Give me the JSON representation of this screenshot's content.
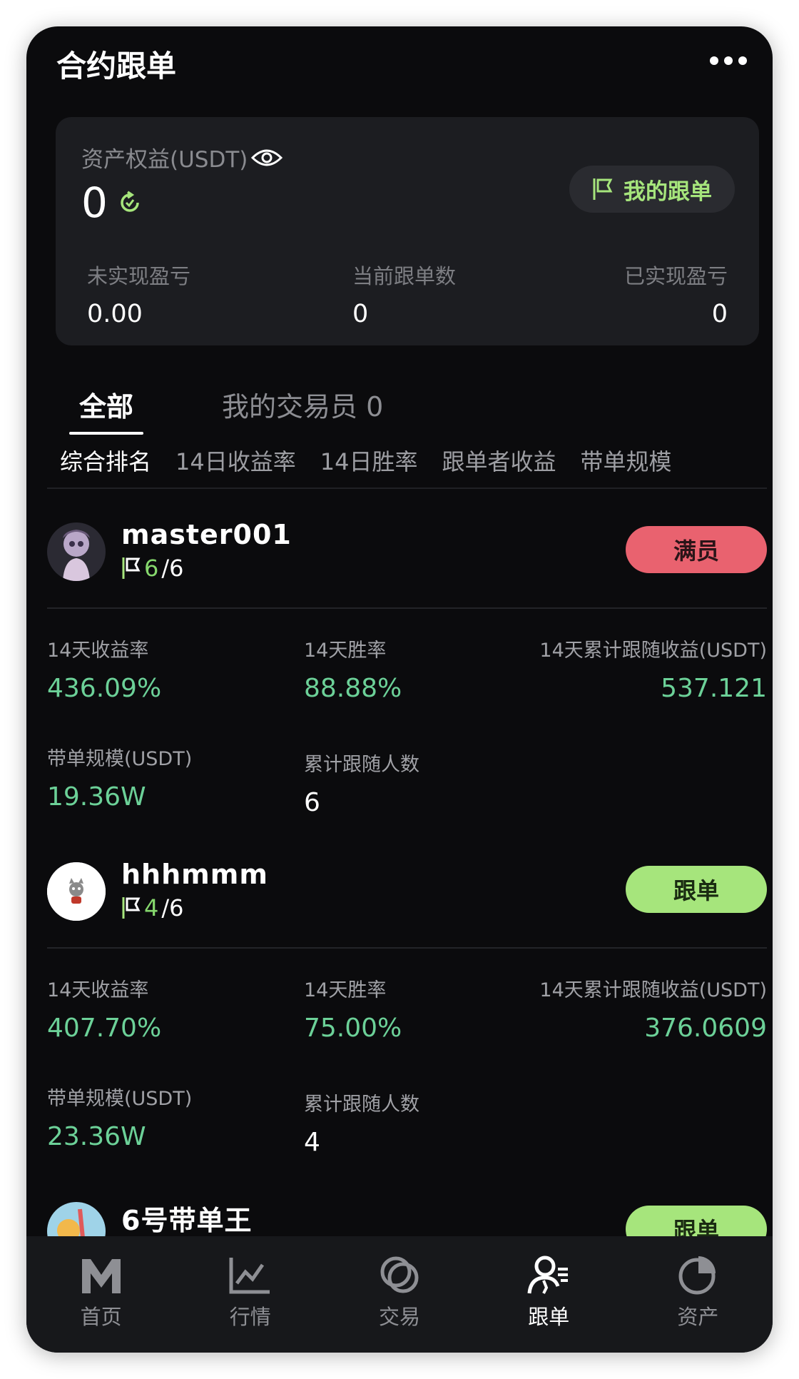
{
  "header": {
    "title": "合约跟单",
    "more_icon": "more-dots-icon"
  },
  "asset_card": {
    "label": "资产权益(USDT)",
    "value": "0",
    "my_follow_label": "我的跟单",
    "stats": [
      {
        "label": "未实现盈亏",
        "value": "0.00"
      },
      {
        "label": "当前跟单数",
        "value": "0"
      },
      {
        "label": "已实现盈亏",
        "value": "0"
      }
    ]
  },
  "tabs": [
    {
      "label": "全部",
      "active": true
    },
    {
      "label": "我的交易员 0",
      "active": false
    }
  ],
  "sort_options": [
    "综合排名",
    "14日收益率",
    "14日胜率",
    "跟单者收益",
    "带单规模"
  ],
  "metric_labels": {
    "roi": "14天收益率",
    "win_rate": "14天胜率",
    "follower_profit": "14天累计跟随收益(USDT)",
    "scale": "带单规模(USDT)",
    "followers": "累计跟随人数"
  },
  "traders": [
    {
      "name": "master001",
      "slots_current": "6",
      "slots_total": "/6",
      "button": "满员",
      "roi": "436.09%",
      "win_rate": "88.88%",
      "follower_profit": "537.121",
      "scale": "19.36W",
      "followers": "6"
    },
    {
      "name": "hhhmmm",
      "slots_current": "4",
      "slots_total": "/6",
      "button": "跟单",
      "roi": "407.70%",
      "win_rate": "75.00%",
      "follower_profit": "376.0609",
      "scale": "23.36W",
      "followers": "4"
    },
    {
      "name": "6号带单王",
      "button": "跟单"
    }
  ],
  "bottom_nav": [
    {
      "label": "首页",
      "icon": "home-m-icon"
    },
    {
      "label": "行情",
      "icon": "market-chart-icon"
    },
    {
      "label": "交易",
      "icon": "trade-circles-icon"
    },
    {
      "label": "跟单",
      "icon": "copy-trade-user-icon",
      "active": true
    },
    {
      "label": "资产",
      "icon": "assets-pie-icon"
    }
  ],
  "colors": {
    "accent_green": "#a6e57c",
    "profit_green": "#6cd198",
    "full_red": "#e9626f",
    "background": "#0b0b0d"
  }
}
